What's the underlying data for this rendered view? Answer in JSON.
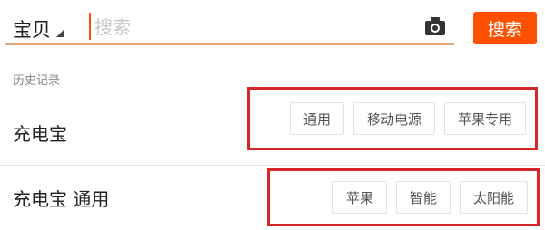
{
  "search": {
    "scope_label": "宝贝",
    "placeholder": "搜索",
    "button_label": "搜索"
  },
  "history": {
    "title": "历史记录",
    "items": [
      {
        "term": "充电宝",
        "tags": [
          "通用",
          "移动电源",
          "苹果专用"
        ]
      },
      {
        "term": "充电宝 通用",
        "tags": [
          "苹果",
          "智能",
          "太阳能"
        ]
      }
    ]
  },
  "colors": {
    "accent": "#ff5000",
    "highlight_box": "#d7262a",
    "placeholder": "#c8c8c8"
  },
  "icons": {
    "camera": "camera-icon",
    "scope_caret": "caret-down-icon"
  }
}
